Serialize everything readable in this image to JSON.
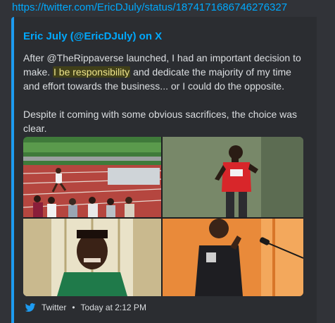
{
  "link_url": "https://twitter.com/EricDJuly/status/1874171686746276327",
  "embed": {
    "author": "Eric July (@EricDJuly) on X",
    "description": {
      "para1_pre": "After @TheRippaverse launched, I had an important decision to make. ",
      "para1_highlight": "I be responsibility",
      "para1_post": " and dedicate the majority of my time and effort towards the business... or I could do the opposite.",
      "para2": "Despite it coming with some obvious sacrifices, the choice was clear."
    },
    "footer": {
      "provider": "Twitter",
      "separator": "•",
      "timestamp": "Today at 2:12 PM"
    }
  },
  "colors": {
    "accent_bar": "#1d9bf0",
    "link": "#00a8fc",
    "highlight": "#f0e68c"
  },
  "icons": {
    "provider_icon": "twitter-bird-icon"
  }
}
